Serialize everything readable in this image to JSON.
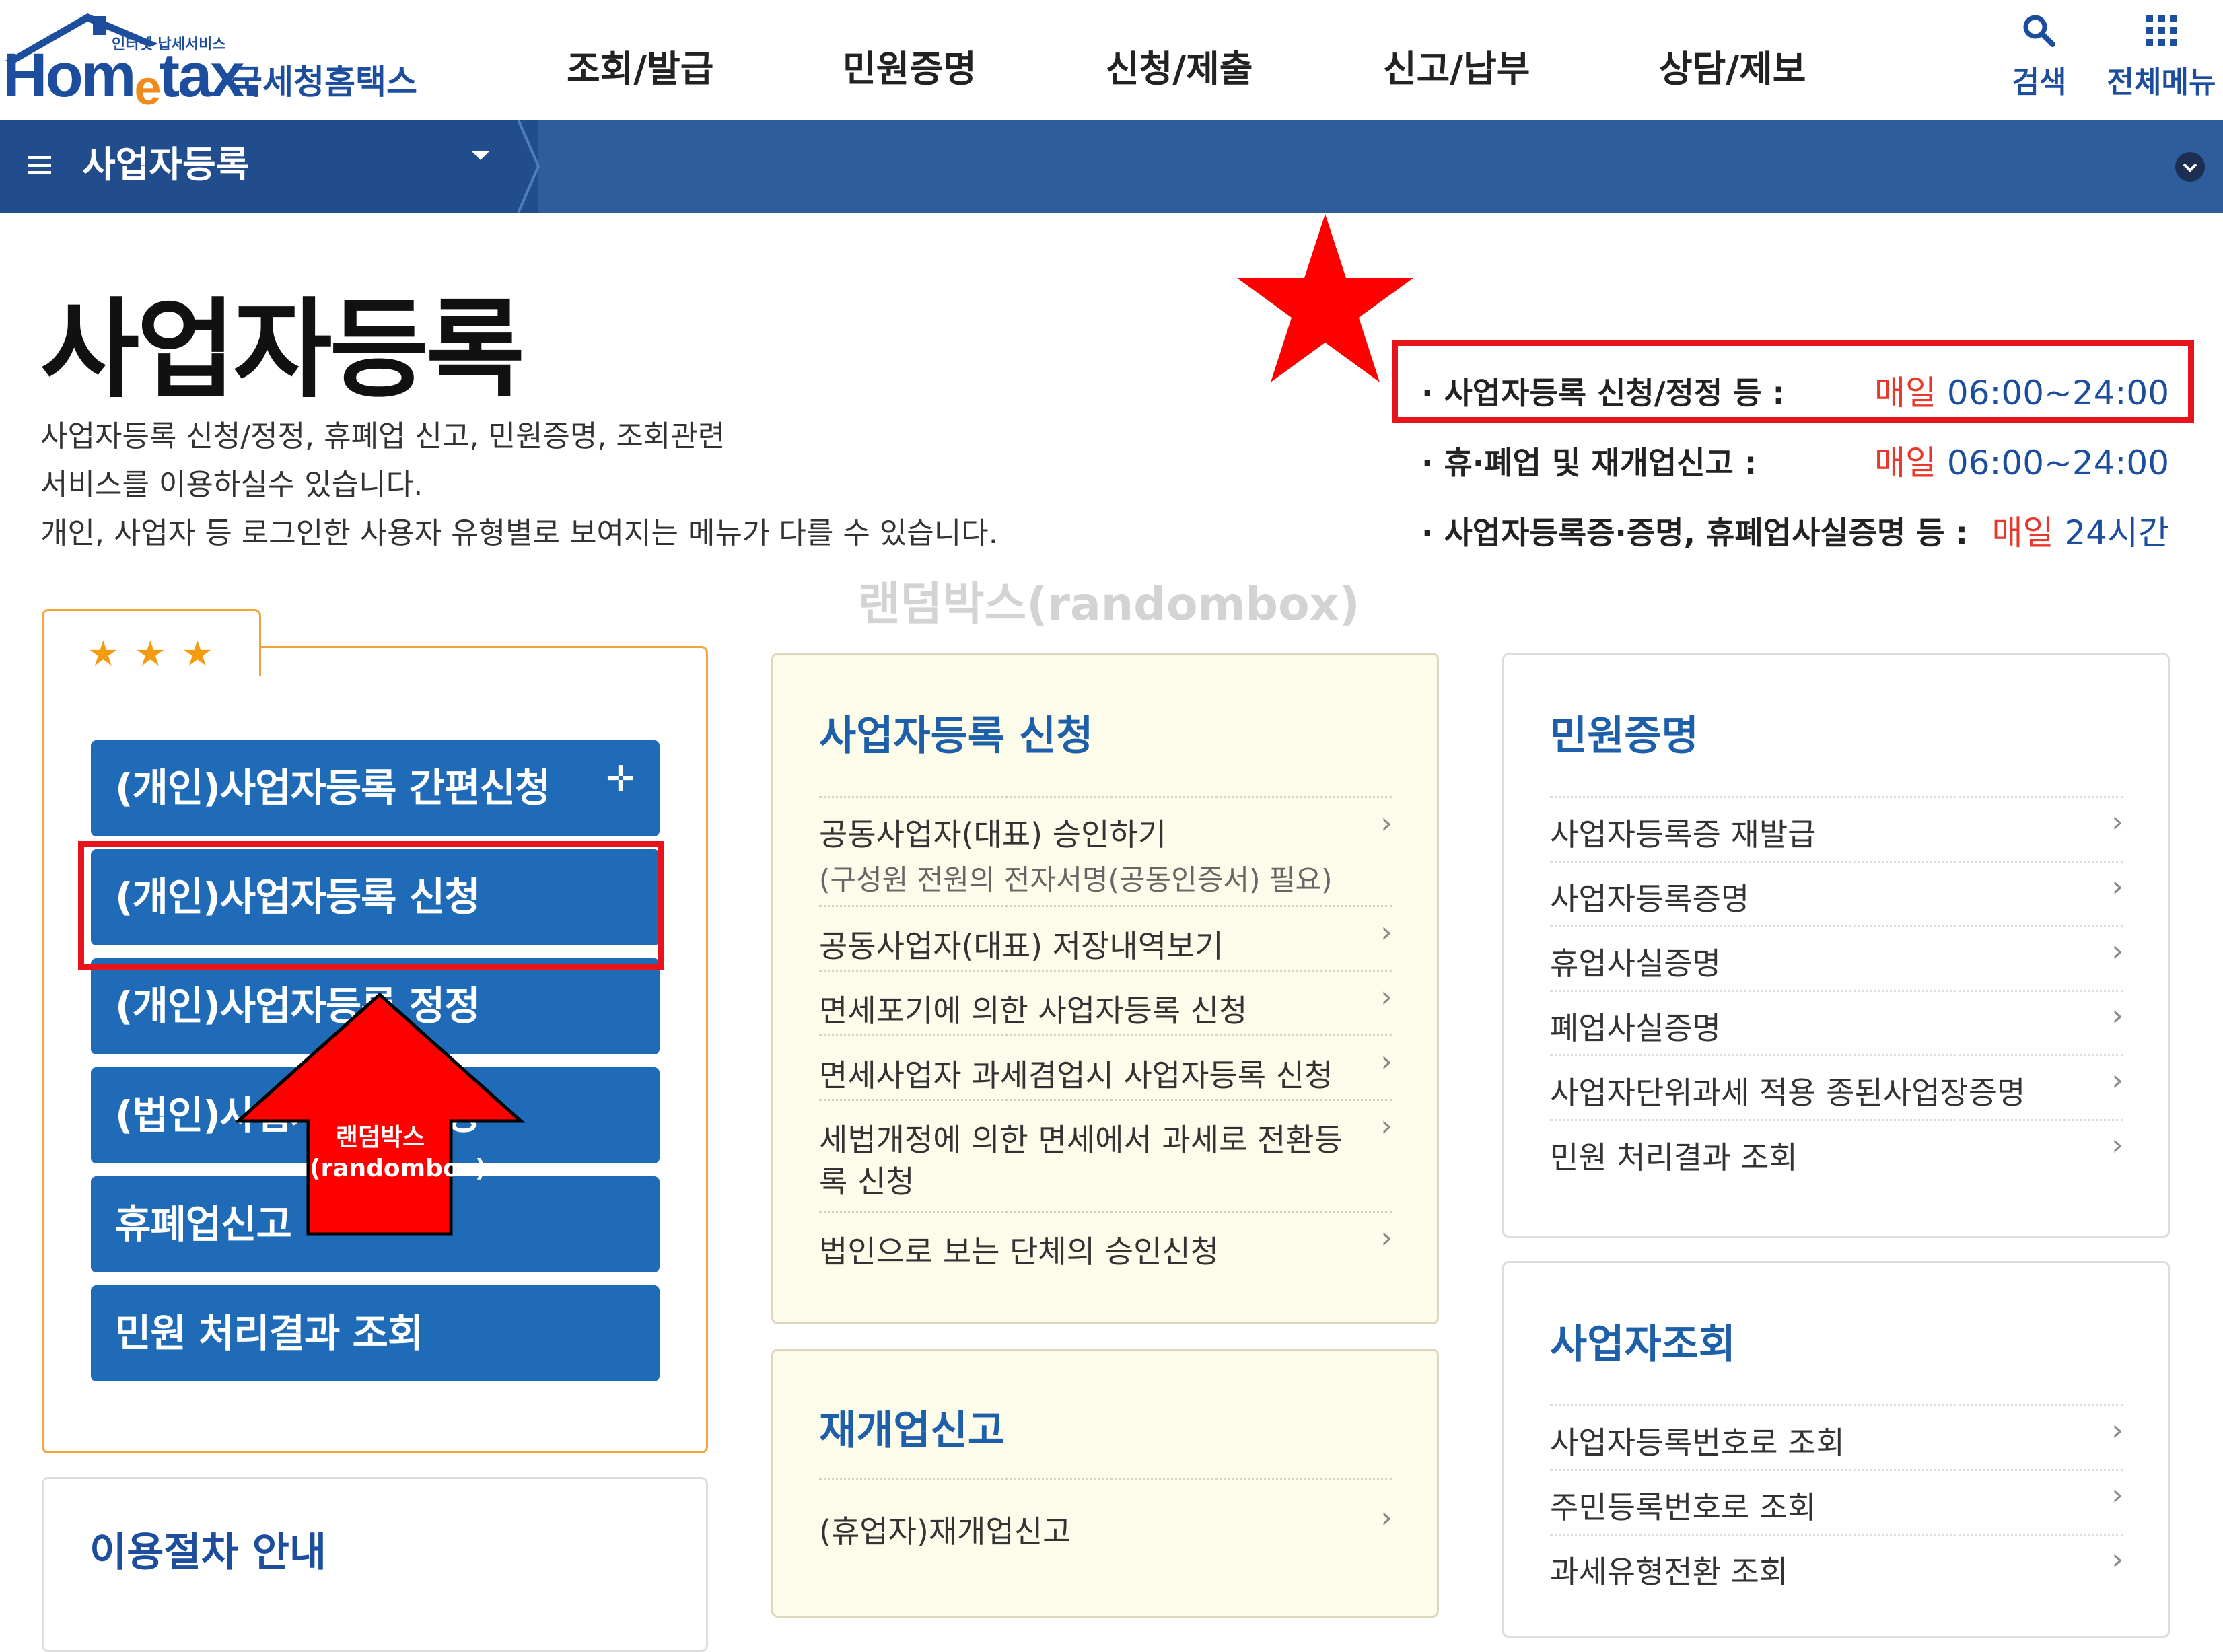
{
  "header": {
    "logo": {
      "tagline": "인터넷 납세서비스",
      "brand_en": "Hometax",
      "brand_ko": "국세청홈택스"
    },
    "menu": [
      "조회/발급",
      "민원증명",
      "신청/제출",
      "신고/납부",
      "상담/제보"
    ],
    "search_label": "검색",
    "all_menu_label": "전체메뉴"
  },
  "subnav": {
    "title": "사업자등록"
  },
  "page": {
    "title": "사업자등록",
    "desc": [
      "사업자등록 신청/정정, 휴폐업 신고, 민원증명, 조회관련",
      "서비스를 이용하실수 있습니다.",
      "개인, 사업자 등 로그인한 사용자 유형별로 보여지는 메뉴가 다를 수 있습니다."
    ]
  },
  "hours": [
    {
      "label": "· 사업자등록 신청/정정 등 :",
      "prefix": "매일",
      "value": "06:00~24:00"
    },
    {
      "label": "· 휴·폐업 및 재개업신고 :",
      "prefix": "매일",
      "value": "06:00~24:00"
    },
    {
      "label": "· 사업자등록증·증명, 휴폐업사실증명 등 :",
      "prefix": "매일",
      "value": "24시간"
    }
  ],
  "watermark": "랜덤박스(randombox)",
  "arrow_label": [
    "랜덤박스",
    "(randombox)"
  ],
  "favorites": {
    "buttons": [
      "(개인)사업자등록 간편신청",
      "(개인)사업자등록 신청",
      "(개인)사업자등록 정정",
      "(법인)사업자등록 신청",
      "휴폐업신고",
      "민원 처리결과 조회"
    ]
  },
  "guide": {
    "title": "이용절차 안내"
  },
  "register_box": {
    "title": "사업자등록 신청",
    "items": [
      {
        "l1": "공동사업자(대표) 승인하기",
        "l2": "(구성원 전원의 전자서명(공동인증서) 필요)"
      },
      {
        "l1": "공동사업자(대표) 저장내역보기"
      },
      {
        "l1": "면세포기에 의한 사업자등록 신청"
      },
      {
        "l1": "면세사업자 과세겸업시 사업자등록 신청"
      },
      {
        "l1": "세법개정에 의한 면세에서 과세로 전환등",
        "l2": "록 신청"
      },
      {
        "l1": "법인으로 보는 단체의 승인신청"
      }
    ]
  },
  "reopen_box": {
    "title": "재개업신고",
    "items": [
      "(휴업자)재개업신고"
    ]
  },
  "cert_box": {
    "title": "민원증명",
    "items": [
      "사업자등록증 재발급",
      "사업자등록증명",
      "휴업사실증명",
      "폐업사실증명",
      "사업자단위과세 적용 종된사업장증명",
      "민원 처리결과 조회"
    ]
  },
  "inquiry_box": {
    "title": "사업자조회",
    "items": [
      "사업자등록번호로 조회",
      "주민등록번호로 조회",
      "과세유형전환 조회"
    ]
  },
  "colors": {
    "primary": "#1d4e9d",
    "button_blue": "#1f6bb8",
    "highlight_red": "#e8141c",
    "accent_orange": "#f3a33a"
  }
}
